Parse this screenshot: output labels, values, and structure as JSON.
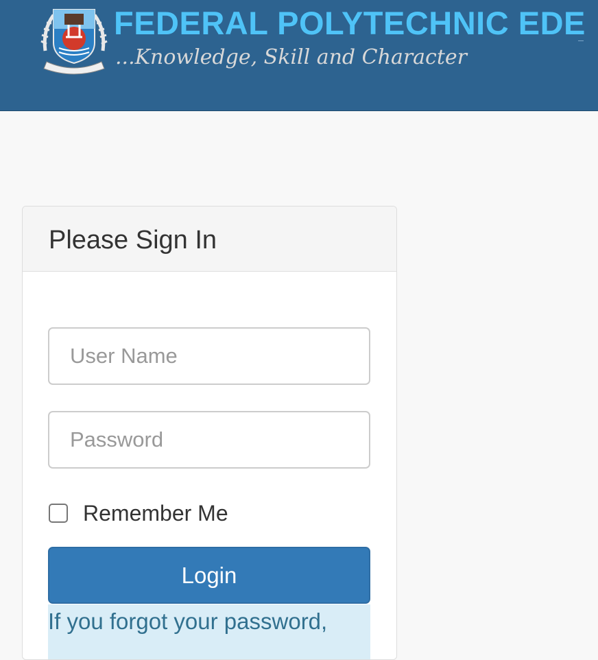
{
  "header": {
    "title": "FEDERAL POLYTECHNIC EDE",
    "tagline": "...Knowledge, Skill and Character",
    "logo_icon": "institution-crest-icon",
    "colors": {
      "background": "#2d6390",
      "title": "#4fc3f7",
      "tagline": "#d8d8d8"
    }
  },
  "login_panel": {
    "title": "Please Sign In",
    "username": {
      "placeholder": "User Name",
      "value": ""
    },
    "password": {
      "placeholder": "Password",
      "value": ""
    },
    "remember_me": {
      "label": "Remember Me",
      "checked": false
    },
    "login_button": "Login",
    "forgot_password_text": "If you forgot your password,",
    "colors": {
      "button": "#337ab7",
      "info_background": "#d9edf7",
      "info_text": "#31708f"
    }
  }
}
